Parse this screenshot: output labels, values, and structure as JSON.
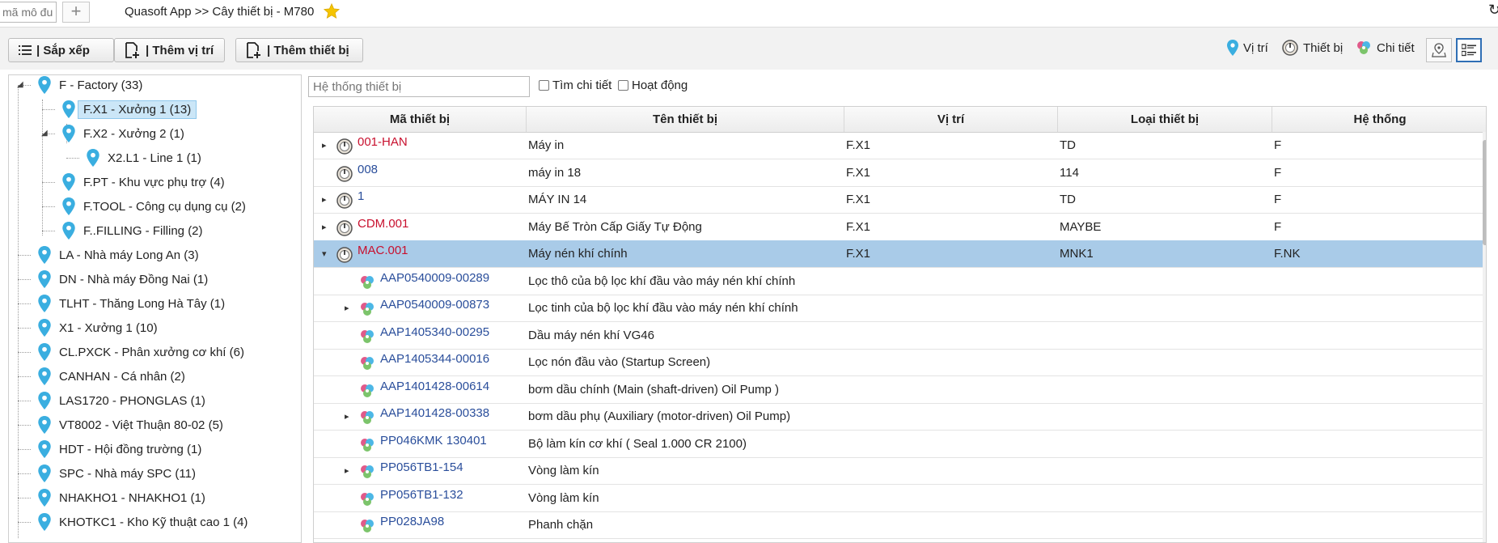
{
  "topbar": {
    "module_placeholder": "mã mô đun",
    "add_tab": "+",
    "breadcrumb": "Quasoft App >> Cây thiết bị - M780"
  },
  "toolbar": {
    "sort_label": "| Sắp xếp",
    "add_location_label": "| Thêm vị trí",
    "add_device_label": "| Thêm thiết bị",
    "legend_location": "Vị trí",
    "legend_device": "Thiết bị",
    "legend_detail": "Chi tiết"
  },
  "tree": [
    {
      "label": "F - Factory (33)"
    },
    {
      "label": "F.X1 - Xưởng 1 (13)"
    },
    {
      "label": "F.X2 - Xưởng 2 (1)"
    },
    {
      "label": "X2.L1 - Line 1 (1)"
    },
    {
      "label": "F.PT - Khu vực phụ trợ (4)"
    },
    {
      "label": "F.TOOL - Công cụ dụng cụ (2)"
    },
    {
      "label": "F..FILLING - Filling (2)"
    },
    {
      "label": "LA - Nhà máy Long An (3)"
    },
    {
      "label": "DN - Nhà máy Đồng Nai (1)"
    },
    {
      "label": "TLHT - Thăng Long Hà Tây (1)"
    },
    {
      "label": "X1 - Xưởng 1 (10)"
    },
    {
      "label": "CL.PXCK - Phân xưởng cơ khí (6)"
    },
    {
      "label": "CANHAN - Cá nhân (2)"
    },
    {
      "label": "LAS1720 - PHONGLAS (1)"
    },
    {
      "label": "VT8002 - Việt Thuận 80-02 (5)"
    },
    {
      "label": "HDT - Hội đồng trường (1)"
    },
    {
      "label": "SPC - Nhà máy SPC (11)"
    },
    {
      "label": "NHAKHO1 - NHAKHO1 (1)"
    },
    {
      "label": "KHOTKC1 - Kho Kỹ thuật cao 1 (4)"
    }
  ],
  "filter": {
    "placeholder": "Hệ thống thiết bị",
    "detail_search_label": "Tìm chi tiết",
    "active_label": "Hoạt động"
  },
  "grid": {
    "columns": [
      "Mã thiết bị",
      "Tên thiết bị",
      "Vị trí",
      "Loại thiết bị",
      "Hệ thống"
    ],
    "rows": [
      {
        "code": "001-HAN",
        "name": "Máy in",
        "location": "F.X1",
        "type": "TD",
        "system": "F"
      },
      {
        "code": "008",
        "name": "máy in 18",
        "location": "F.X1",
        "type": "114",
        "system": "F"
      },
      {
        "code": "1",
        "name": "MÁY IN 14",
        "location": "F.X1",
        "type": "TD",
        "system": "F"
      },
      {
        "code": "CDM.001",
        "name": "Máy Bế Tròn Cấp Giấy Tự Động",
        "location": "F.X1",
        "type": "MAYBE",
        "system": "F"
      },
      {
        "code": "MAC.001",
        "name": "Máy nén khí chính",
        "location": "F.X1",
        "type": "MNK1",
        "system": "F.NK"
      },
      {
        "code": "AAP0540009-00289",
        "name": "Lọc thô của bộ lọc khí đầu vào máy nén khí chính",
        "location": "",
        "type": "",
        "system": ""
      },
      {
        "code": "AAP0540009-00873",
        "name": "Lọc tinh của bộ lọc khí đầu vào máy nén khí chính",
        "location": "",
        "type": "",
        "system": ""
      },
      {
        "code": "AAP1405340-00295",
        "name": "Dầu máy nén khí VG46",
        "location": "",
        "type": "",
        "system": ""
      },
      {
        "code": "AAP1405344-00016",
        "name": "Lọc nón đầu vào (Startup Screen)",
        "location": "",
        "type": "",
        "system": ""
      },
      {
        "code": "AAP1401428-00614",
        "name": "bơm dầu chính (Main (shaft-driven) Oil Pump )",
        "location": "",
        "type": "",
        "system": ""
      },
      {
        "code": "AAP1401428-00338",
        "name": "bơm dầu phụ (Auxiliary (motor-driven) Oil Pump)",
        "location": "",
        "type": "",
        "system": ""
      },
      {
        "code": "PP046KMK 130401",
        "name": "Bộ làm kín cơ khí ( Seal 1.000 CR 2100)",
        "location": "",
        "type": "",
        "system": ""
      },
      {
        "code": "PP056TB1-154",
        "name": "Vòng làm kín",
        "location": "",
        "type": "",
        "system": ""
      },
      {
        "code": "PP056TB1-132",
        "name": "Vòng làm kín",
        "location": "",
        "type": "",
        "system": ""
      },
      {
        "code": "PP028JA98",
        "name": "Phanh chặn",
        "location": "",
        "type": "",
        "system": ""
      }
    ]
  },
  "colors": {
    "selection": "#a9cbe8",
    "tree_selection": "#cbe6f7",
    "code_red": "#c8102e",
    "code_blue": "#2a4e9b",
    "pin": "#3aaee0",
    "star": "#f5c400"
  }
}
